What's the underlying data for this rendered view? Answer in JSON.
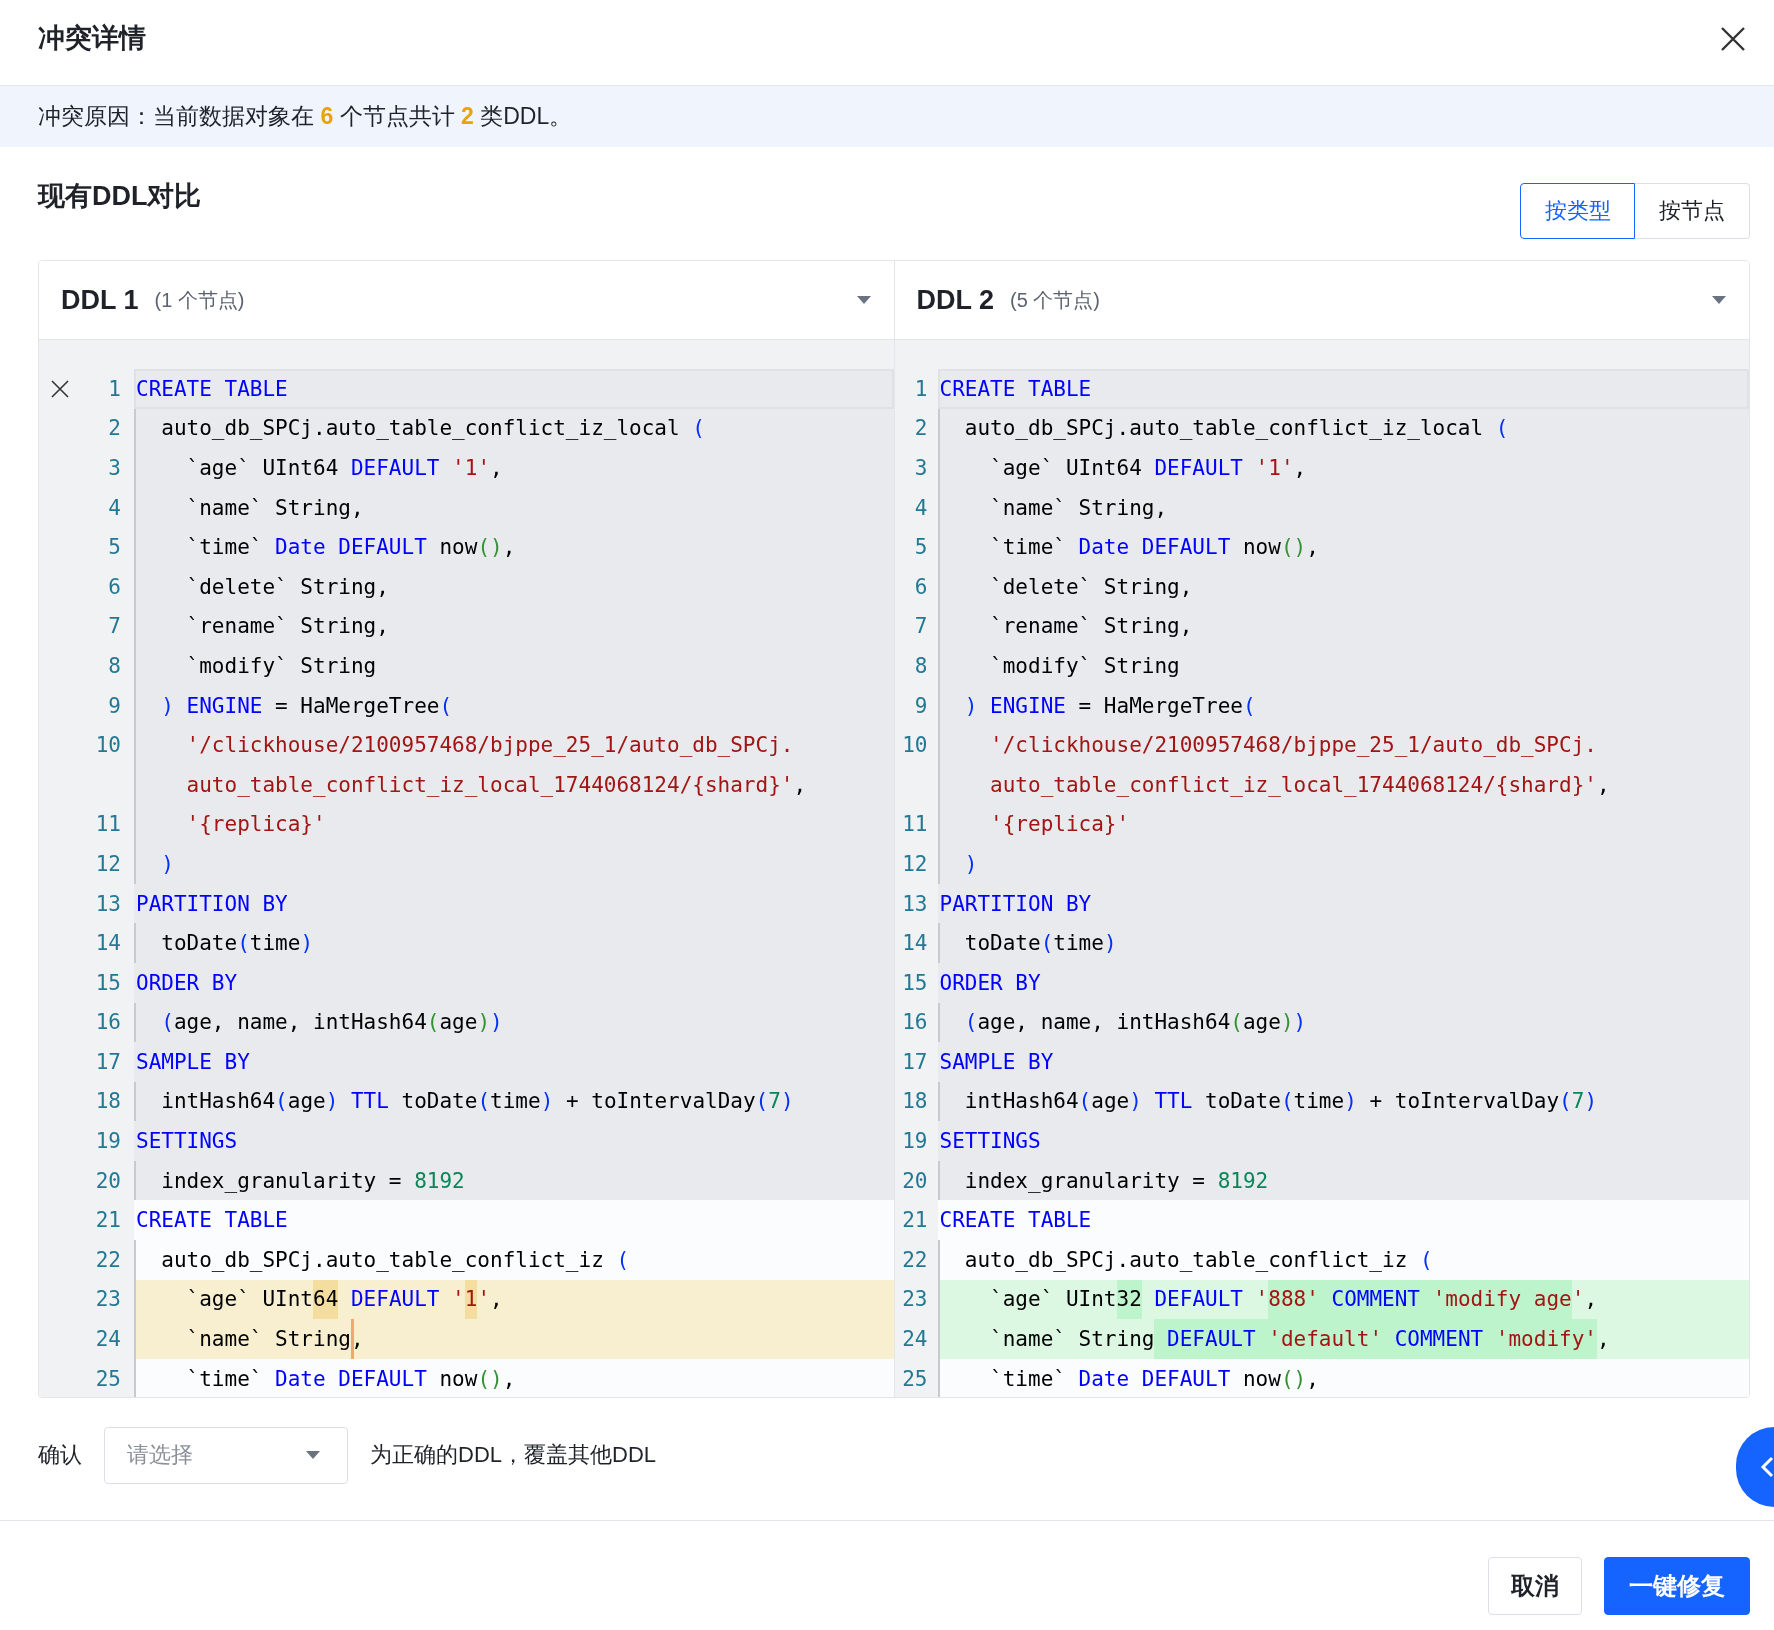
{
  "dialog": {
    "title": "冲突详情"
  },
  "banner": {
    "text": "冲突原因：当前数据对象在 **6** 个节点共计 **2** 类DDL。"
  },
  "section": {
    "title": "现有DDL对比",
    "view_toggle": [
      {
        "label": "按类型",
        "selected": true
      },
      {
        "label": "按节点",
        "selected": false
      }
    ]
  },
  "panes": [
    {
      "title": "DDL 1",
      "node_count": "(1 个节点)",
      "lines": [
        {
          "no": "1",
          "in_block": true,
          "removed": false,
          "added": false,
          "indent_guide": false,
          "current": true,
          "fold": true,
          "tokens": [
            {
              "kind": "keyword",
              "text": "CREATE TABLE"
            }
          ]
        },
        {
          "no": "2",
          "in_block": true,
          "removed": false,
          "added": false,
          "indent_guide": true,
          "current": false,
          "fold": false,
          "tokens": [
            {
              "kind": "plain",
              "text": "  auto_db_SPCj.auto_table_conflict_iz_local "
            },
            {
              "kind": "bracket1",
              "text": "("
            }
          ]
        },
        {
          "no": "3",
          "in_block": true,
          "removed": false,
          "added": false,
          "indent_guide": true,
          "current": false,
          "fold": false,
          "tokens": [
            {
              "kind": "plain",
              "text": "    `age` UInt64 "
            },
            {
              "kind": "keyword",
              "text": "DEFAULT "
            },
            {
              "kind": "string",
              "text": "'1'"
            },
            {
              "kind": "plain",
              "text": ","
            }
          ]
        },
        {
          "no": "4",
          "in_block": true,
          "removed": false,
          "added": false,
          "indent_guide": true,
          "current": false,
          "fold": false,
          "tokens": [
            {
              "kind": "plain",
              "text": "    `name` String,"
            }
          ]
        },
        {
          "no": "5",
          "in_block": true,
          "removed": false,
          "added": false,
          "indent_guide": true,
          "current": false,
          "fold": false,
          "tokens": [
            {
              "kind": "plain",
              "text": "    `time` "
            },
            {
              "kind": "keyword",
              "text": "Date DEFAULT"
            },
            {
              "kind": "plain",
              "text": " now"
            },
            {
              "kind": "bracket2",
              "text": "()"
            },
            {
              "kind": "plain",
              "text": ","
            }
          ]
        },
        {
          "no": "6",
          "in_block": true,
          "removed": false,
          "added": false,
          "indent_guide": true,
          "current": false,
          "fold": false,
          "tokens": [
            {
              "kind": "plain",
              "text": "    `delete` String,"
            }
          ]
        },
        {
          "no": "7",
          "in_block": true,
          "removed": false,
          "added": false,
          "indent_guide": true,
          "current": false,
          "fold": false,
          "tokens": [
            {
              "kind": "plain",
              "text": "    `rename` String,"
            }
          ]
        },
        {
          "no": "8",
          "in_block": true,
          "removed": false,
          "added": false,
          "indent_guide": true,
          "current": false,
          "fold": false,
          "tokens": [
            {
              "kind": "plain",
              "text": "    `modify` String"
            }
          ]
        },
        {
          "no": "9",
          "in_block": true,
          "removed": false,
          "added": false,
          "indent_guide": true,
          "current": false,
          "fold": false,
          "tokens": [
            {
              "kind": "bracket1",
              "text": "  ) "
            },
            {
              "kind": "keyword",
              "text": "ENGINE"
            },
            {
              "kind": "plain",
              "text": " = HaMergeTree"
            },
            {
              "kind": "bracket1",
              "text": "("
            }
          ]
        },
        {
          "no": "10",
          "in_block": true,
          "removed": false,
          "added": false,
          "indent_guide": true,
          "current": false,
          "fold": false,
          "tokens": [
            {
              "kind": "string",
              "text": "    '/clickhouse/2100957468/bjppe_25_1/auto_db_SPCj."
            }
          ]
        },
        {
          "in_block": true,
          "removed": false,
          "added": false,
          "indent_guide": true,
          "current": false,
          "fold": false,
          "tokens": [
            {
              "kind": "string",
              "text": "    auto_table_conflict_iz_local_1744068124/{shard}'"
            },
            {
              "kind": "plain",
              "text": ","
            }
          ]
        },
        {
          "no": "11",
          "in_block": true,
          "removed": false,
          "added": false,
          "indent_guide": true,
          "current": false,
          "fold": false,
          "tokens": [
            {
              "kind": "string",
              "text": "    '{replica}'"
            }
          ]
        },
        {
          "no": "12",
          "in_block": true,
          "removed": false,
          "added": false,
          "indent_guide": true,
          "current": false,
          "fold": false,
          "tokens": [
            {
              "kind": "bracket1",
              "text": "  )"
            }
          ]
        },
        {
          "no": "13",
          "in_block": true,
          "removed": false,
          "added": false,
          "indent_guide": false,
          "current": false,
          "fold": false,
          "tokens": [
            {
              "kind": "keyword",
              "text": "PARTITION BY"
            }
          ]
        },
        {
          "no": "14",
          "in_block": true,
          "removed": false,
          "added": false,
          "indent_guide": true,
          "current": false,
          "fold": false,
          "tokens": [
            {
              "kind": "plain",
              "text": "  toDate"
            },
            {
              "kind": "bracket1",
              "text": "("
            },
            {
              "kind": "plain",
              "text": "time"
            },
            {
              "kind": "bracket1",
              "text": ")"
            }
          ]
        },
        {
          "no": "15",
          "in_block": true,
          "removed": false,
          "added": false,
          "indent_guide": false,
          "current": false,
          "fold": false,
          "tokens": [
            {
              "kind": "keyword",
              "text": "ORDER BY"
            }
          ]
        },
        {
          "no": "16",
          "in_block": true,
          "removed": false,
          "added": false,
          "indent_guide": true,
          "current": false,
          "fold": false,
          "tokens": [
            {
              "kind": "bracket1",
              "text": "  ("
            },
            {
              "kind": "plain",
              "text": "age, name, intHash64"
            },
            {
              "kind": "bracket2",
              "text": "("
            },
            {
              "kind": "plain",
              "text": "age"
            },
            {
              "kind": "bracket2",
              "text": ")"
            },
            {
              "kind": "bracket1",
              "text": ")"
            }
          ]
        },
        {
          "no": "17",
          "in_block": true,
          "removed": false,
          "added": false,
          "indent_guide": false,
          "current": false,
          "fold": false,
          "tokens": [
            {
              "kind": "keyword",
              "text": "SAMPLE BY"
            }
          ]
        },
        {
          "no": "18",
          "in_block": true,
          "removed": false,
          "added": false,
          "indent_guide": true,
          "current": false,
          "fold": false,
          "tokens": [
            {
              "kind": "plain",
              "text": "  intHash64"
            },
            {
              "kind": "bracket1",
              "text": "("
            },
            {
              "kind": "plain",
              "text": "age"
            },
            {
              "kind": "bracket1",
              "text": ") "
            },
            {
              "kind": "keyword",
              "text": "TTL"
            },
            {
              "kind": "plain",
              "text": " toDate"
            },
            {
              "kind": "bracket1",
              "text": "("
            },
            {
              "kind": "plain",
              "text": "time"
            },
            {
              "kind": "bracket1",
              "text": ")"
            },
            {
              "kind": "plain",
              "text": " + toIntervalDay"
            },
            {
              "kind": "bracket1",
              "text": "("
            },
            {
              "kind": "number",
              "text": "7"
            },
            {
              "kind": "bracket1",
              "text": ")"
            }
          ]
        },
        {
          "no": "19",
          "in_block": true,
          "removed": false,
          "added": false,
          "indent_guide": false,
          "current": false,
          "fold": false,
          "tokens": [
            {
              "kind": "keyword",
              "text": "SETTINGS"
            }
          ]
        },
        {
          "no": "20",
          "in_block": true,
          "removed": false,
          "added": false,
          "indent_guide": true,
          "current": false,
          "fold": false,
          "tokens": [
            {
              "kind": "plain",
              "text": "  index_granularity = "
            },
            {
              "kind": "number",
              "text": "8192"
            }
          ]
        },
        {
          "no": "21",
          "in_block": false,
          "removed": false,
          "added": false,
          "indent_guide": false,
          "current": false,
          "fold": false,
          "tokens": [
            {
              "kind": "keyword",
              "text": "CREATE TABLE"
            }
          ]
        },
        {
          "no": "22",
          "in_block": false,
          "removed": false,
          "added": false,
          "indent_guide": true,
          "current": false,
          "fold": false,
          "tokens": [
            {
              "kind": "plain",
              "text": "  auto_db_SPCj.auto_table_conflict_iz "
            },
            {
              "kind": "bracket1",
              "text": "("
            }
          ]
        },
        {
          "no": "23",
          "in_block": false,
          "removed": true,
          "added": false,
          "indent_guide": true,
          "current": false,
          "fold": false,
          "tokens": [
            {
              "kind": "plain",
              "text": "    `age` UInt"
            },
            {
              "kind": "diffplain",
              "text": "64"
            },
            {
              "kind": "keyword",
              "text": " DEFAULT "
            },
            {
              "kind": "string",
              "text": "'"
            },
            {
              "kind": "diffstring",
              "text": "1"
            },
            {
              "kind": "string",
              "text": "'"
            },
            {
              "kind": "plain",
              "text": ","
            }
          ]
        },
        {
          "no": "24",
          "in_block": false,
          "removed": true,
          "added": false,
          "indent_guide": true,
          "current": false,
          "fold": false,
          "tokens": [
            {
              "kind": "plain",
              "text": "    `name` String"
            },
            {
              "kind": "caretplain",
              "text": ","
            }
          ]
        },
        {
          "no": "25",
          "in_block": false,
          "removed": false,
          "added": false,
          "indent_guide": true,
          "current": false,
          "fold": false,
          "tokens": [
            {
              "kind": "plain",
              "text": "    `time` "
            },
            {
              "kind": "keyword",
              "text": "Date DEFAULT"
            },
            {
              "kind": "plain",
              "text": " now"
            },
            {
              "kind": "bracket2",
              "text": "()"
            },
            {
              "kind": "plain",
              "text": ","
            }
          ]
        }
      ]
    },
    {
      "title": "DDL 2",
      "node_count": "(5 个节点)",
      "lines": [
        {
          "no": "1",
          "in_block": true,
          "removed": false,
          "added": false,
          "indent_guide": false,
          "current": true,
          "fold": false,
          "tokens": [
            {
              "kind": "keyword",
              "text": "CREATE TABLE"
            }
          ]
        },
        {
          "no": "2",
          "in_block": true,
          "removed": false,
          "added": false,
          "indent_guide": true,
          "current": false,
          "fold": false,
          "tokens": [
            {
              "kind": "plain",
              "text": "  auto_db_SPCj.auto_table_conflict_iz_local "
            },
            {
              "kind": "bracket1",
              "text": "("
            }
          ]
        },
        {
          "no": "3",
          "in_block": true,
          "removed": false,
          "added": false,
          "indent_guide": true,
          "current": false,
          "fold": false,
          "tokens": [
            {
              "kind": "plain",
              "text": "    `age` UInt64 "
            },
            {
              "kind": "keyword",
              "text": "DEFAULT "
            },
            {
              "kind": "string",
              "text": "'1'"
            },
            {
              "kind": "plain",
              "text": ","
            }
          ]
        },
        {
          "no": "4",
          "in_block": true,
          "removed": false,
          "added": false,
          "indent_guide": true,
          "current": false,
          "fold": false,
          "tokens": [
            {
              "kind": "plain",
              "text": "    `name` String,"
            }
          ]
        },
        {
          "no": "5",
          "in_block": true,
          "removed": false,
          "added": false,
          "indent_guide": true,
          "current": false,
          "fold": false,
          "tokens": [
            {
              "kind": "plain",
              "text": "    `time` "
            },
            {
              "kind": "keyword",
              "text": "Date DEFAULT"
            },
            {
              "kind": "plain",
              "text": " now"
            },
            {
              "kind": "bracket2",
              "text": "()"
            },
            {
              "kind": "plain",
              "text": ","
            }
          ]
        },
        {
          "no": "6",
          "in_block": true,
          "removed": false,
          "added": false,
          "indent_guide": true,
          "current": false,
          "fold": false,
          "tokens": [
            {
              "kind": "plain",
              "text": "    `delete` String,"
            }
          ]
        },
        {
          "no": "7",
          "in_block": true,
          "removed": false,
          "added": false,
          "indent_guide": true,
          "current": false,
          "fold": false,
          "tokens": [
            {
              "kind": "plain",
              "text": "    `rename` String,"
            }
          ]
        },
        {
          "no": "8",
          "in_block": true,
          "removed": false,
          "added": false,
          "indent_guide": true,
          "current": false,
          "fold": false,
          "tokens": [
            {
              "kind": "plain",
              "text": "    `modify` String"
            }
          ]
        },
        {
          "no": "9",
          "in_block": true,
          "removed": false,
          "added": false,
          "indent_guide": true,
          "current": false,
          "fold": false,
          "tokens": [
            {
              "kind": "bracket1",
              "text": "  ) "
            },
            {
              "kind": "keyword",
              "text": "ENGINE"
            },
            {
              "kind": "plain",
              "text": " = HaMergeTree"
            },
            {
              "kind": "bracket1",
              "text": "("
            }
          ]
        },
        {
          "no": "10",
          "in_block": true,
          "removed": false,
          "added": false,
          "indent_guide": true,
          "current": false,
          "fold": false,
          "tokens": [
            {
              "kind": "string",
              "text": "    '/clickhouse/2100957468/bjppe_25_1/auto_db_SPCj."
            }
          ]
        },
        {
          "in_block": true,
          "removed": false,
          "added": false,
          "indent_guide": true,
          "current": false,
          "fold": false,
          "tokens": [
            {
              "kind": "string",
              "text": "    auto_table_conflict_iz_local_1744068124/{shard}'"
            },
            {
              "kind": "plain",
              "text": ","
            }
          ]
        },
        {
          "no": "11",
          "in_block": true,
          "removed": false,
          "added": false,
          "indent_guide": true,
          "current": false,
          "fold": false,
          "tokens": [
            {
              "kind": "string",
              "text": "    '{replica}'"
            }
          ]
        },
        {
          "no": "12",
          "in_block": true,
          "removed": false,
          "added": false,
          "indent_guide": true,
          "current": false,
          "fold": false,
          "tokens": [
            {
              "kind": "bracket1",
              "text": "  )"
            }
          ]
        },
        {
          "no": "13",
          "in_block": true,
          "removed": false,
          "added": false,
          "indent_guide": false,
          "current": false,
          "fold": false,
          "tokens": [
            {
              "kind": "keyword",
              "text": "PARTITION BY"
            }
          ]
        },
        {
          "no": "14",
          "in_block": true,
          "removed": false,
          "added": false,
          "indent_guide": true,
          "current": false,
          "fold": false,
          "tokens": [
            {
              "kind": "plain",
              "text": "  toDate"
            },
            {
              "kind": "bracket1",
              "text": "("
            },
            {
              "kind": "plain",
              "text": "time"
            },
            {
              "kind": "bracket1",
              "text": ")"
            }
          ]
        },
        {
          "no": "15",
          "in_block": true,
          "removed": false,
          "added": false,
          "indent_guide": false,
          "current": false,
          "fold": false,
          "tokens": [
            {
              "kind": "keyword",
              "text": "ORDER BY"
            }
          ]
        },
        {
          "no": "16",
          "in_block": true,
          "removed": false,
          "added": false,
          "indent_guide": true,
          "current": false,
          "fold": false,
          "tokens": [
            {
              "kind": "bracket1",
              "text": "  ("
            },
            {
              "kind": "plain",
              "text": "age, name, intHash64"
            },
            {
              "kind": "bracket2",
              "text": "("
            },
            {
              "kind": "plain",
              "text": "age"
            },
            {
              "kind": "bracket2",
              "text": ")"
            },
            {
              "kind": "bracket1",
              "text": ")"
            }
          ]
        },
        {
          "no": "17",
          "in_block": true,
          "removed": false,
          "added": false,
          "indent_guide": false,
          "current": false,
          "fold": false,
          "tokens": [
            {
              "kind": "keyword",
              "text": "SAMPLE BY"
            }
          ]
        },
        {
          "no": "18",
          "in_block": true,
          "removed": false,
          "added": false,
          "indent_guide": true,
          "current": false,
          "fold": false,
          "tokens": [
            {
              "kind": "plain",
              "text": "  intHash64"
            },
            {
              "kind": "bracket1",
              "text": "("
            },
            {
              "kind": "plain",
              "text": "age"
            },
            {
              "kind": "bracket1",
              "text": ") "
            },
            {
              "kind": "keyword",
              "text": "TTL"
            },
            {
              "kind": "plain",
              "text": " toDate"
            },
            {
              "kind": "bracket1",
              "text": "("
            },
            {
              "kind": "plain",
              "text": "time"
            },
            {
              "kind": "bracket1",
              "text": ")"
            },
            {
              "kind": "plain",
              "text": " + toIntervalDay"
            },
            {
              "kind": "bracket1",
              "text": "("
            },
            {
              "kind": "number",
              "text": "7"
            },
            {
              "kind": "bracket1",
              "text": ")"
            }
          ]
        },
        {
          "no": "19",
          "in_block": true,
          "removed": false,
          "added": false,
          "indent_guide": false,
          "current": false,
          "fold": false,
          "tokens": [
            {
              "kind": "keyword",
              "text": "SETTINGS"
            }
          ]
        },
        {
          "no": "20",
          "in_block": true,
          "removed": false,
          "added": false,
          "indent_guide": true,
          "current": false,
          "fold": false,
          "tokens": [
            {
              "kind": "plain",
              "text": "  index_granularity = "
            },
            {
              "kind": "number",
              "text": "8192"
            }
          ]
        },
        {
          "no": "21",
          "in_block": false,
          "removed": false,
          "added": false,
          "indent_guide": false,
          "current": false,
          "fold": false,
          "tokens": [
            {
              "kind": "keyword",
              "text": "CREATE TABLE"
            }
          ]
        },
        {
          "no": "22",
          "in_block": false,
          "removed": false,
          "added": false,
          "indent_guide": true,
          "current": false,
          "fold": false,
          "tokens": [
            {
              "kind": "plain",
              "text": "  auto_db_SPCj.auto_table_conflict_iz "
            },
            {
              "kind": "bracket1",
              "text": "("
            }
          ]
        },
        {
          "no": "23",
          "in_block": false,
          "removed": false,
          "added": true,
          "indent_guide": true,
          "current": false,
          "fold": false,
          "tokens": [
            {
              "kind": "plain",
              "text": "    `age` UInt"
            },
            {
              "kind": "diffplain",
              "text": "32"
            },
            {
              "kind": "keyword",
              "text": " DEFAULT "
            },
            {
              "kind": "string",
              "text": "'"
            },
            {
              "kind": "diffstring",
              "text": "888' "
            },
            {
              "kind": "diffkeyword",
              "text": "COMMENT "
            },
            {
              "kind": "diffstring",
              "text": "'modify age"
            },
            {
              "kind": "string",
              "text": "'"
            },
            {
              "kind": "plain",
              "text": ","
            }
          ]
        },
        {
          "no": "24",
          "in_block": false,
          "removed": false,
          "added": true,
          "indent_guide": true,
          "current": false,
          "fold": false,
          "tokens": [
            {
              "kind": "plain",
              "text": "    `name` String"
            },
            {
              "kind": "diffkeyword",
              "text": " DEFAULT "
            },
            {
              "kind": "diffstring",
              "text": "'default' "
            },
            {
              "kind": "diffkeyword",
              "text": "COMMENT "
            },
            {
              "kind": "diffstring",
              "text": "'modify'"
            },
            {
              "kind": "plain",
              "text": ","
            }
          ]
        },
        {
          "no": "25",
          "in_block": false,
          "removed": false,
          "added": false,
          "indent_guide": true,
          "current": false,
          "fold": false,
          "tokens": [
            {
              "kind": "plain",
              "text": "    `time` "
            },
            {
              "kind": "keyword",
              "text": "Date DEFAULT"
            },
            {
              "kind": "plain",
              "text": " now"
            },
            {
              "kind": "bracket2",
              "text": "()"
            },
            {
              "kind": "plain",
              "text": ","
            }
          ]
        }
      ]
    }
  ],
  "confirm_row": {
    "prefix": "确认",
    "select": {
      "placeholder": "请选择"
    },
    "suffix": "为正确的DDL，覆盖其他DDL"
  },
  "buttons": [
    {
      "label": "取消",
      "kind": "default"
    },
    {
      "label": "一键修复",
      "kind": "primary"
    }
  ]
}
